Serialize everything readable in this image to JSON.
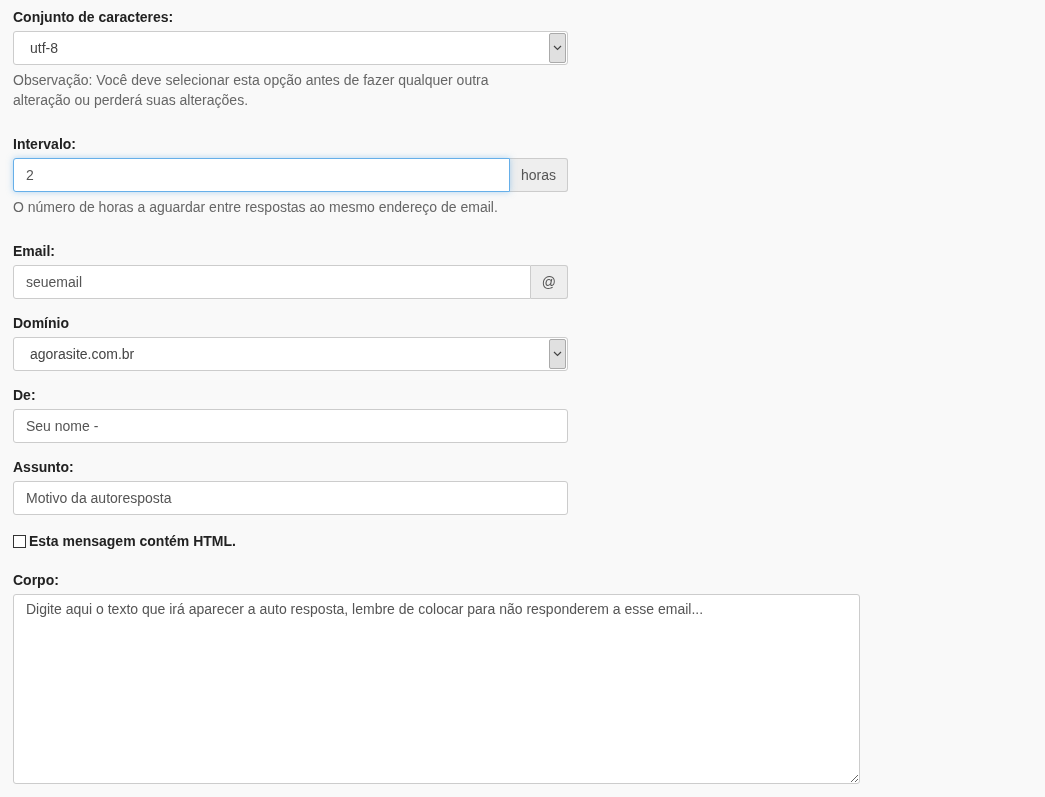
{
  "fields": [
    {
      "kind": "select",
      "label": "Conjunto de caracteres:",
      "value": "utf-8",
      "help": "Observação: Você deve selecionar esta opção antes de fazer qualquer outra alteração ou perderá suas alterações."
    },
    {
      "kind": "addon",
      "label": "Intervalo:",
      "value": "2",
      "addon": "horas",
      "focused": true,
      "help": "O número de horas a aguardar entre respostas ao mesmo endereço de email."
    },
    {
      "kind": "addon",
      "label": "Email:",
      "value": "seuemail",
      "addon": "@",
      "focused": false
    },
    {
      "kind": "select",
      "label": "Domínio",
      "value": "agorasite.com.br"
    },
    {
      "kind": "text",
      "label": "De:",
      "value": "Seu nome -"
    },
    {
      "kind": "text",
      "label": "Assunto:",
      "value": "Motivo da autoresposta"
    },
    {
      "kind": "checkbox",
      "label": "Esta mensagem contém HTML.",
      "checked": false
    },
    {
      "kind": "textarea",
      "label": "Corpo:",
      "value": "Digite aqui o texto que irá aparecer a auto resposta, lembre de colocar para não responderem a esse email..."
    }
  ]
}
